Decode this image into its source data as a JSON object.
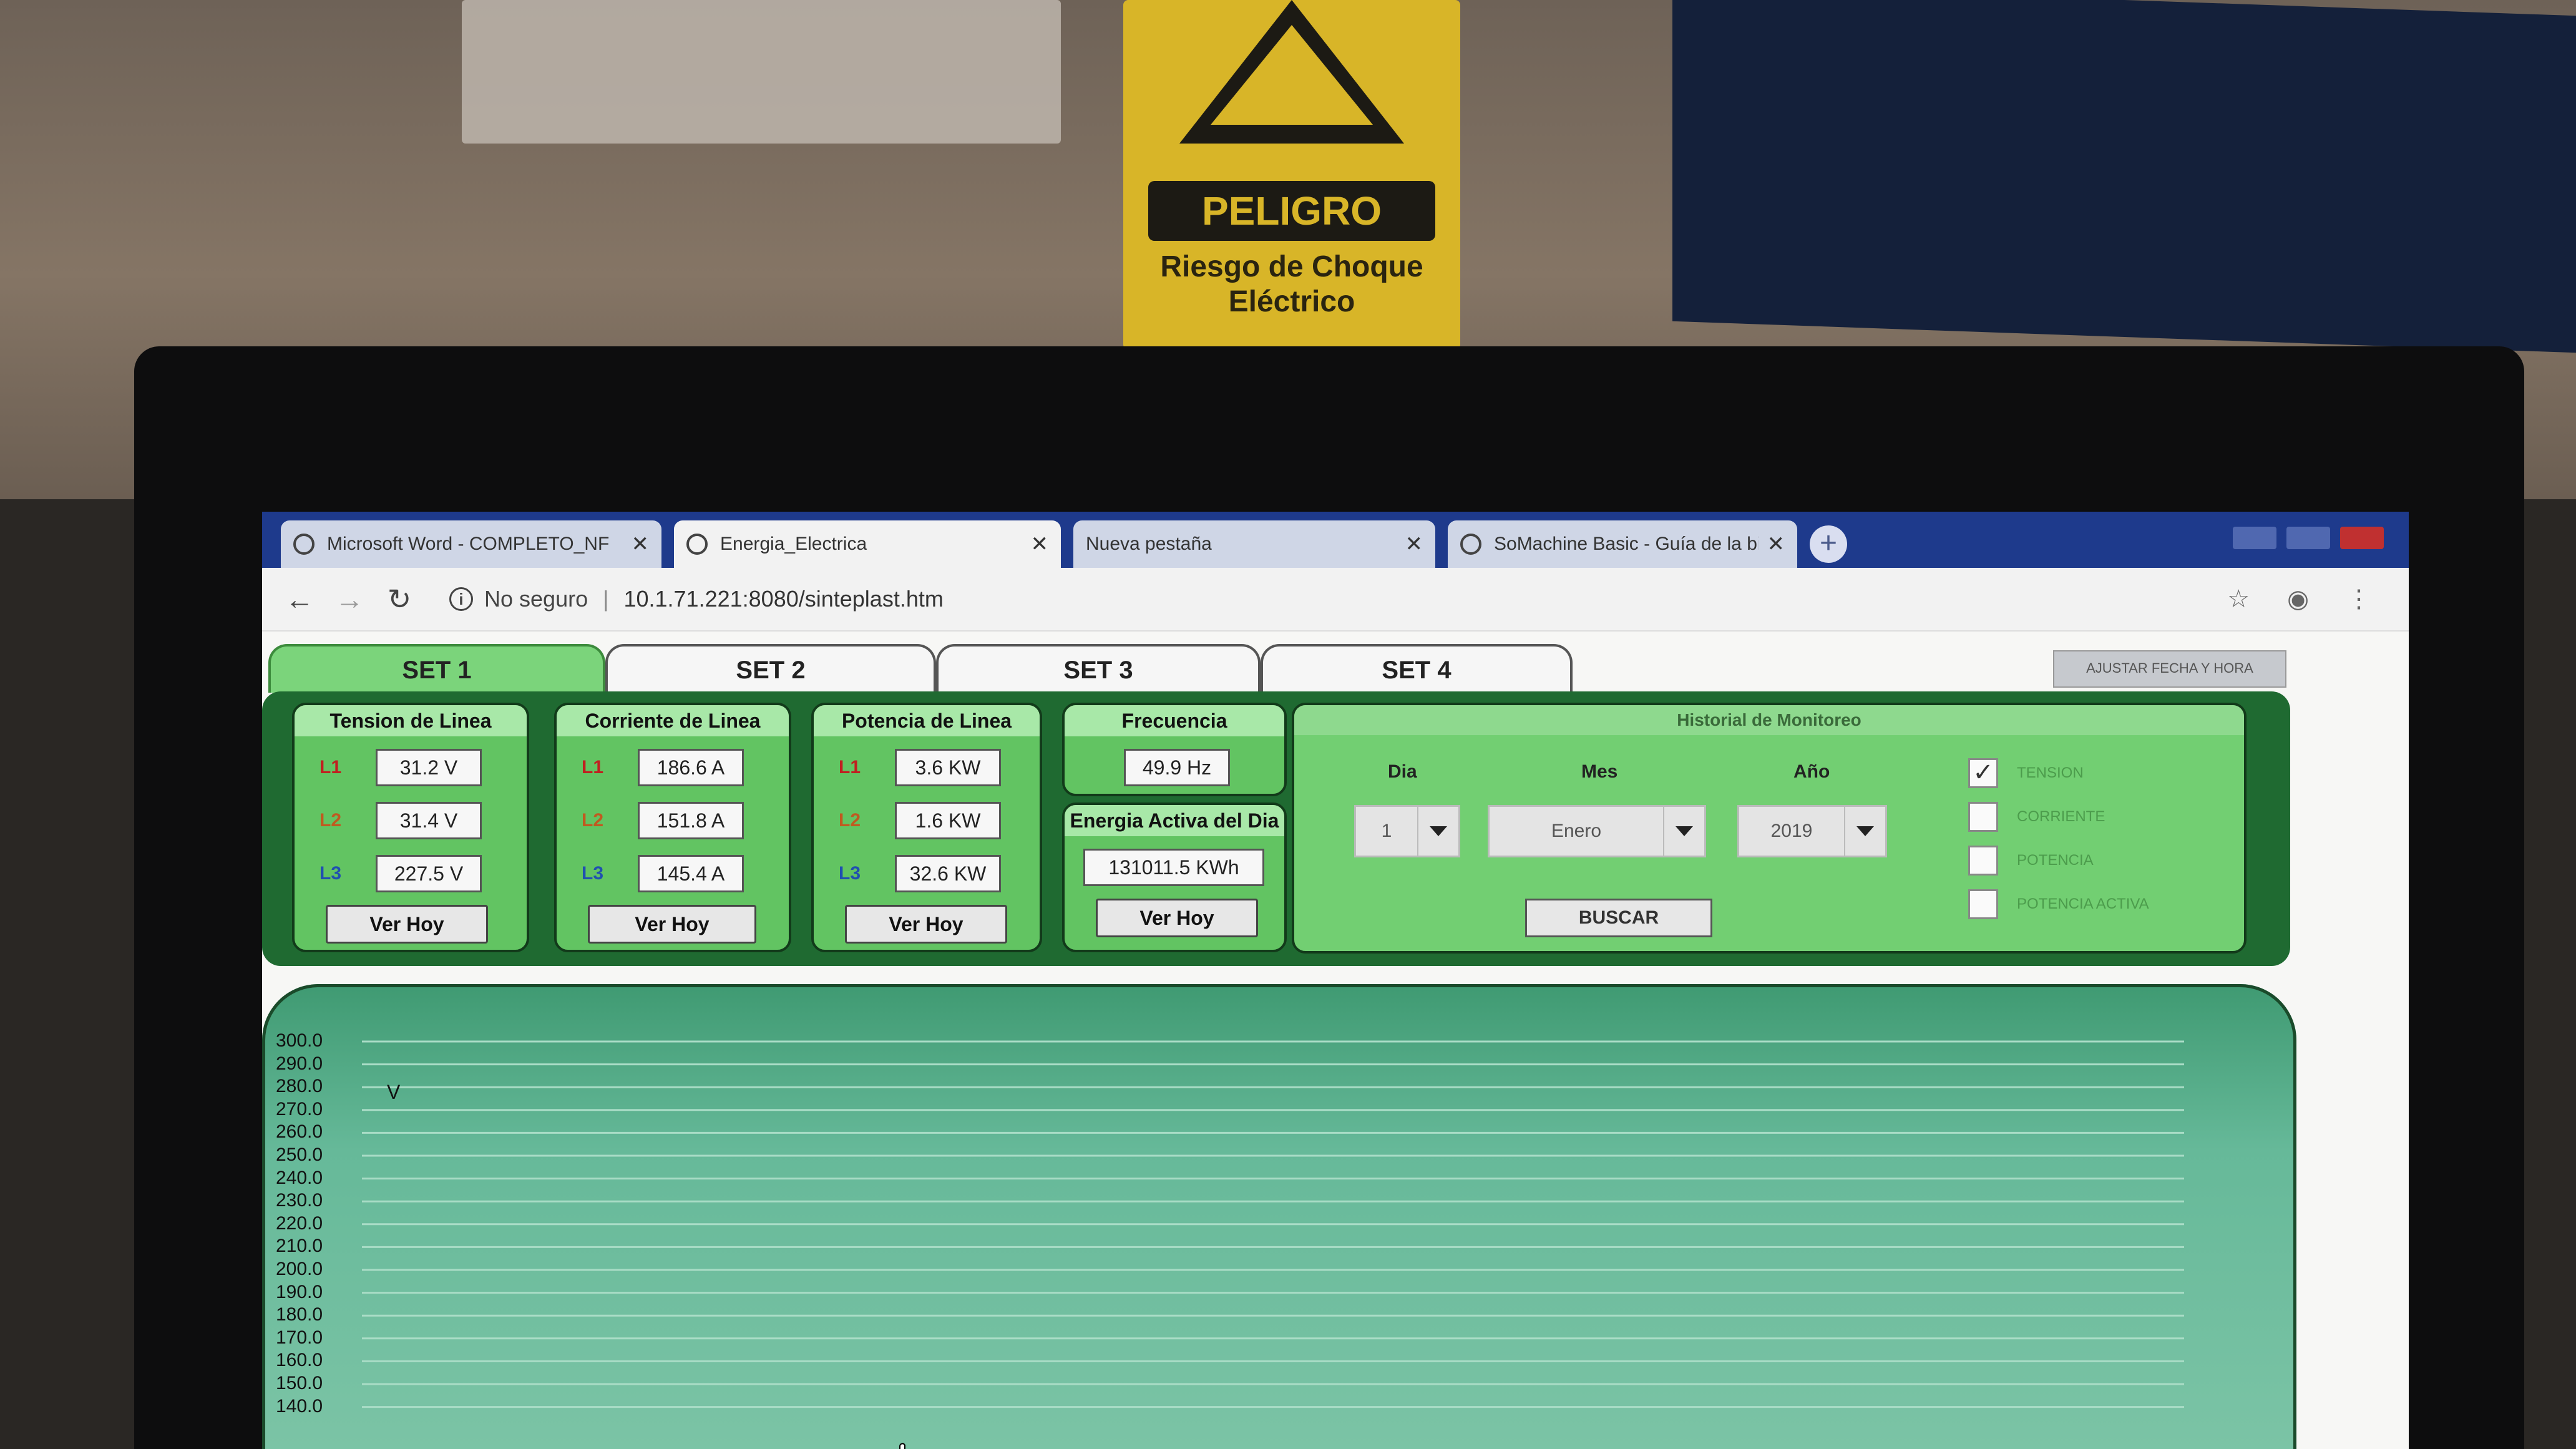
{
  "background": {
    "sign_title": "PELIGRO",
    "sign_subtitle": "Riesgo de Choque Eléctrico"
  },
  "browser": {
    "tabs": [
      {
        "label": "Microsoft Word - COMPLETO_NF",
        "icon": "globe-icon",
        "active": false
      },
      {
        "label": "Energia_Electrica",
        "icon": "globe-icon",
        "active": true
      },
      {
        "label": "Nueva pestaña",
        "icon": "",
        "active": false
      },
      {
        "label": "SoMachine Basic - Guía de la bi",
        "icon": "globe-icon",
        "active": false
      }
    ],
    "security": "No seguro",
    "url": "10.1.71.221:8080/sinteplast.htm"
  },
  "page": {
    "set_tabs": [
      "SET 1",
      "SET 2",
      "SET 3",
      "SET 4"
    ],
    "active_set": "SET 1",
    "adjust_button": "AJUSTAR FECHA Y HORA",
    "tension": {
      "title": "Tension de Linea",
      "lines": [
        {
          "label": "L1",
          "value": "31.2 V"
        },
        {
          "label": "L2",
          "value": "31.4 V"
        },
        {
          "label": "L3",
          "value": "227.5 V"
        }
      ],
      "button": "Ver Hoy"
    },
    "corriente": {
      "title": "Corriente de Linea",
      "lines": [
        {
          "label": "L1",
          "value": "186.6 A"
        },
        {
          "label": "L2",
          "value": "151.8 A"
        },
        {
          "label": "L3",
          "value": "145.4 A"
        }
      ],
      "button": "Ver Hoy"
    },
    "potencia": {
      "title": "Potencia de Linea",
      "lines": [
        {
          "label": "L1",
          "value": "3.6 KW"
        },
        {
          "label": "L2",
          "value": "1.6 KW"
        },
        {
          "label": "L3",
          "value": "32.6 KW"
        }
      ],
      "button": "Ver Hoy"
    },
    "frecuencia": {
      "title": "Frecuencia",
      "value": "49.9 Hz"
    },
    "energia": {
      "title": "Energia Activa del Dia",
      "value": "131011.5 KWh",
      "button": "Ver Hoy"
    },
    "historial": {
      "title": "Historial de Monitoreo",
      "dia_label": "Dia",
      "dia_value": "1",
      "mes_label": "Mes",
      "mes_value": "Enero",
      "anio_label": "Año",
      "anio_value": "2019",
      "buscar": "BUSCAR",
      "checks": [
        {
          "label": "TENSION",
          "checked": true
        },
        {
          "label": "CORRIENTE",
          "checked": false
        },
        {
          "label": "POTENCIA",
          "checked": false
        },
        {
          "label": "POTENCIA ACTIVA",
          "checked": false
        }
      ]
    },
    "chart": {
      "unit": "V",
      "yticks": [
        "300.0",
        "290.0",
        "280.0",
        "270.0",
        "260.0",
        "250.0",
        "240.0",
        "230.0",
        "220.0",
        "210.0",
        "200.0",
        "190.0",
        "180.0",
        "170.0",
        "160.0",
        "150.0",
        "140.0"
      ]
    }
  },
  "colors": {
    "panel_dark": "#1f6a31",
    "panel_green": "#62c462",
    "title_green": "#a8e8a8",
    "chart_green": "#66b999",
    "browser_blue": "#1e3a8c"
  }
}
